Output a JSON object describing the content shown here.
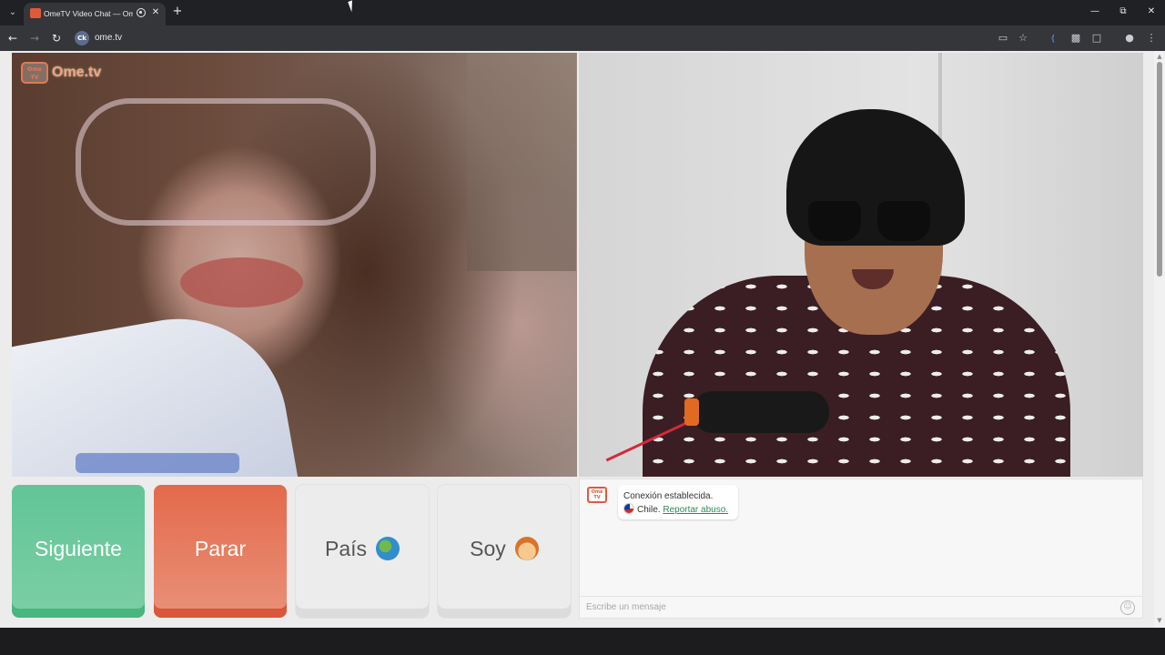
{
  "browser": {
    "tab_title": "OmeTV Video Chat — Ome",
    "url": "ome.tv",
    "site_badge": "Ck",
    "icons": {
      "tab_search": "chevron-down-icon",
      "close": "close-icon",
      "new_tab": "plus-icon",
      "back": "arrow-left-icon",
      "forward": "arrow-right-icon",
      "reload": "reload-icon",
      "install": "install-icon",
      "bookmark": "star-icon",
      "extensions": "puzzle-icon",
      "profile": "avatar-icon",
      "menu": "kebab-menu-icon"
    }
  },
  "page": {
    "logo_text": "Ome.tv",
    "logo_badge": "Ome TV",
    "buttons": {
      "next": "Siguiente",
      "stop": "Parar",
      "country": "País",
      "gender": "Soy"
    },
    "button_icons": {
      "country": "globe-icon",
      "gender": "boy-face-icon"
    },
    "chat": {
      "status": "Conexión establecida.",
      "country": "Chile.",
      "report": "Reportar abuso.",
      "placeholder": "Escribe un mensaje"
    },
    "colors": {
      "next": "#62c597",
      "stop": "#e46a4b",
      "brand": "#e07a52"
    }
  }
}
